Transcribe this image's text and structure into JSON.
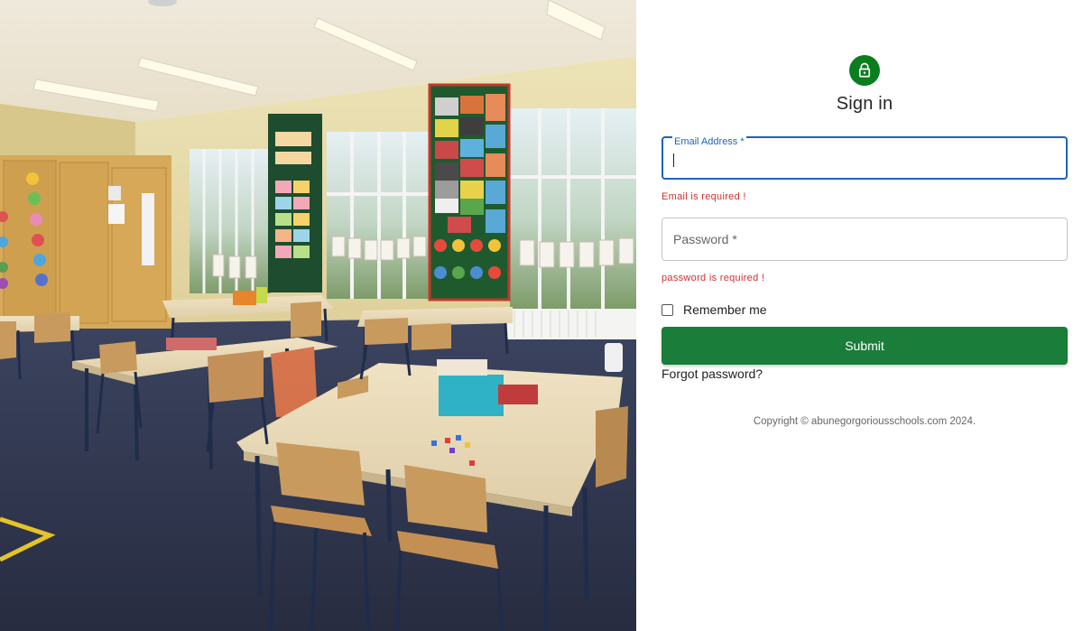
{
  "login": {
    "title": "Sign in",
    "icon": "lock-icon",
    "email_label": "Email Address *",
    "email_value": "",
    "email_error": "Email is required !",
    "password_placeholder": "Password *",
    "password_error": "password is required !",
    "remember_label": "Remember me",
    "remember_checked": false,
    "submit_label": "Submit",
    "forgot_label": "Forgot password?",
    "copyright": "Copyright © abunegorgoriousschools.com 2024."
  },
  "colors": {
    "accent_green": "#1a7d3a",
    "icon_green": "#0a7d1f",
    "focus_blue": "#1f63b8",
    "error_red": "#d32f2f"
  },
  "hero": {
    "alt": "classroom-photo"
  }
}
